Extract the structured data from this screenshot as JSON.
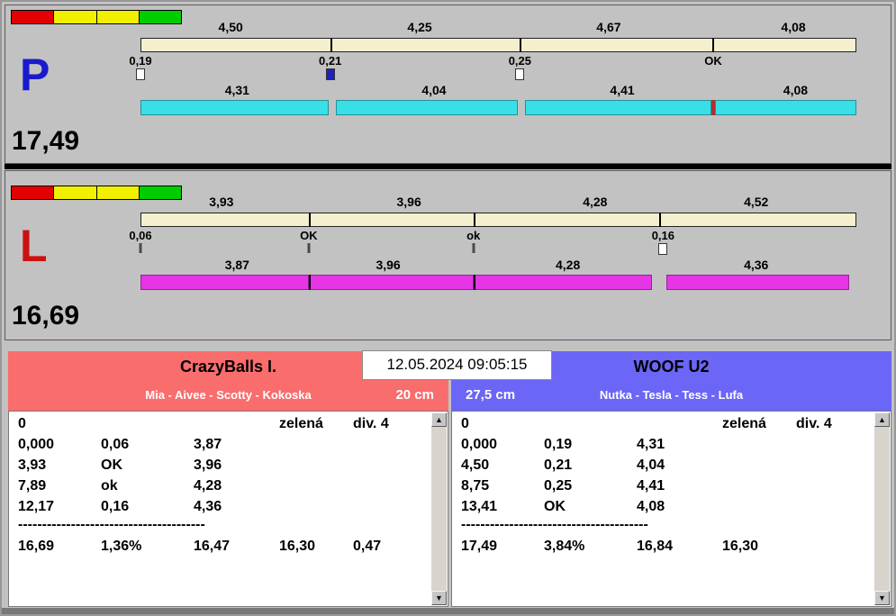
{
  "window": {
    "datetime": "12.05.2024 09:05:15"
  },
  "p_lane": {
    "letter": "P",
    "total": "17,49",
    "split_labels": [
      "4,50",
      "4,25",
      "4,67",
      "4,08"
    ],
    "cross_labels": [
      "0,19",
      "0,21",
      "0,25",
      "OK"
    ],
    "dog_labels": [
      "4,31",
      "4,04",
      "4,41",
      "4,08"
    ]
  },
  "l_lane": {
    "letter": "L",
    "total": "16,69",
    "split_labels": [
      "3,93",
      "3,96",
      "4,28",
      "4,52"
    ],
    "cross_labels": [
      "0,06",
      "OK",
      "ok",
      "0,16"
    ],
    "dog_labels": [
      "3,87",
      "3,96",
      "4,28",
      "4,36"
    ]
  },
  "left_team": {
    "name": "CrazyBalls I.",
    "members": "Mia - Aivee - Scotty - Kokoska",
    "height": "20 cm",
    "table": {
      "header": [
        "0",
        "zelená",
        "div. 4"
      ],
      "rows": [
        [
          "0,000",
          "0,06",
          "3,87"
        ],
        [
          "3,93",
          "OK",
          "3,96"
        ],
        [
          "7,89",
          "ok",
          "4,28"
        ],
        [
          "12,17",
          "0,16",
          "4,36"
        ]
      ],
      "separator": "---------------------------------------",
      "totals": [
        "16,69",
        "1,36%",
        "16,47",
        "16,30",
        "0,47"
      ]
    }
  },
  "right_team": {
    "name": "WOOF U2",
    "members": "Nutka - Tesla - Tess - Lufa",
    "height": "27,5 cm",
    "table": {
      "header": [
        "0",
        "zelená",
        "div. 4"
      ],
      "rows": [
        [
          "0,000",
          "0,19",
          "4,31"
        ],
        [
          "4,50",
          "0,21",
          "4,04"
        ],
        [
          "8,75",
          "0,25",
          "4,41"
        ],
        [
          "13,41",
          "OK",
          "4,08"
        ]
      ],
      "separator": "---------------------------------------",
      "totals": [
        "17,49",
        "3,84%",
        "16,84",
        "16,30",
        ""
      ]
    }
  },
  "scrollbar": {
    "up_arrow": "▲",
    "down_arrow": "▼"
  },
  "colors": {
    "background": "#c2c2c2",
    "split_bar": "#f3efcf",
    "p_dog_bar": "#38dfe7",
    "l_dog_bar": "#e535e5",
    "left_header": "#f96d6d",
    "right_header": "#6b66f5",
    "p_letter": "#1a1acc",
    "l_letter": "#cc1111",
    "marker_blue": "#2222bb",
    "red_divider": "#b03030",
    "lights": [
      "#e30000",
      "#f0f000",
      "#f0f000",
      "#00cc00"
    ]
  }
}
